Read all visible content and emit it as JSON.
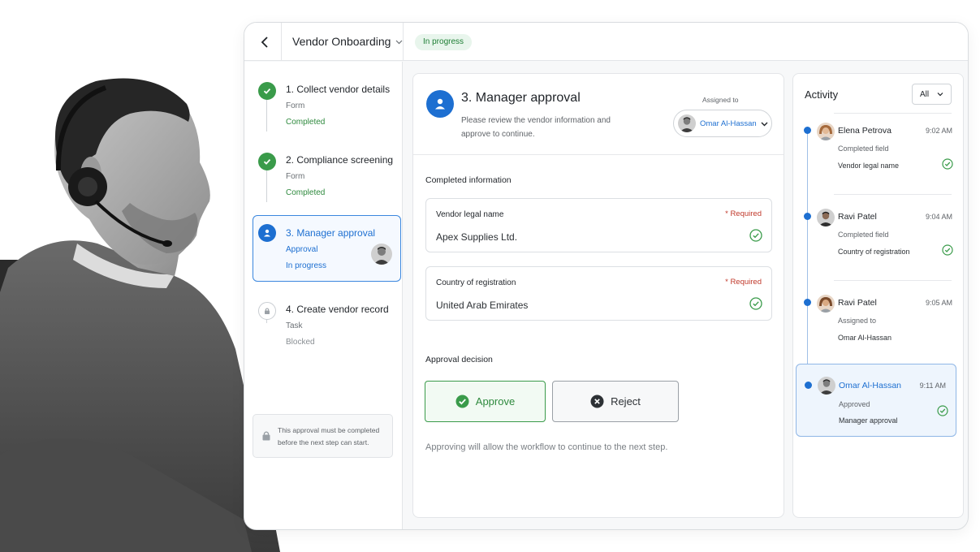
{
  "header": {
    "workflow_title": "Vendor Onboarding",
    "status": "In progress"
  },
  "steps": [
    {
      "title": "1. Collect vendor details",
      "type": "Form",
      "status": "Completed"
    },
    {
      "title": "2. Compliance screening",
      "type": "Form",
      "status": "Completed"
    },
    {
      "title": "3. Manager approval",
      "type": "Approval",
      "status": "In progress"
    },
    {
      "title": "4. Create vendor record",
      "type": "Task",
      "status": "Blocked"
    }
  ],
  "note": {
    "text": "This approval must be completed before the next step can start."
  },
  "main": {
    "title": "3. Manager approval",
    "description": "Please review the vendor information and approve to continue.",
    "assigned_label": "Assigned to",
    "assignee": "Omar Al-Hassan",
    "completed_info_label": "Completed information",
    "fields": [
      {
        "label": "Vendor legal name",
        "required": "* Required",
        "value": "Apex Supplies Ltd."
      },
      {
        "label": "Country of registration",
        "required": "* Required",
        "value": "United Arab Emirates"
      }
    ],
    "decision_label": "Approval decision",
    "approve_label": "Approve",
    "reject_label": "Reject",
    "help_text": "Approving will allow the workflow to continue to the next step."
  },
  "activity": {
    "title": "Activity",
    "filter": "All",
    "items": [
      {
        "who": "Elena Petrova",
        "time": "9:02 AM",
        "what": "Completed field",
        "detail": "Vendor legal name"
      },
      {
        "who": "Ravi Patel",
        "time": "9:04 AM",
        "what": "Completed field",
        "detail": "Country of registration"
      },
      {
        "who": "Ravi Patel",
        "time": "9:05 AM",
        "what": "Assigned to",
        "detail": "Omar Al-Hassan"
      },
      {
        "who": "Omar Al-Hassan",
        "time": "9:11 AM",
        "what": "Approved",
        "detail": "Manager approval"
      }
    ]
  },
  "colors": {
    "accent_blue": "#1d6fd1",
    "success_green": "#3a9b4a",
    "required_red": "#c0392b"
  }
}
